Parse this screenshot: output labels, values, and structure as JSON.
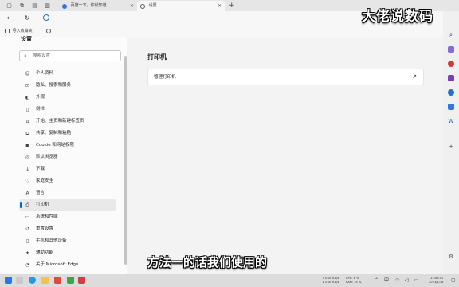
{
  "tabs": [
    {
      "title": "百度一下，你就知道",
      "active": false
    },
    {
      "title": "设置",
      "active": true
    }
  ],
  "favorites": [
    {
      "label": "导入收藏夹",
      "icon": "import-favorites-icon"
    },
    {
      "label": "",
      "icon": "folder-icon"
    }
  ],
  "settings": {
    "heading": "设置",
    "search_placeholder": "搜索设置",
    "nav": [
      {
        "label": "个人资料",
        "icon": "profile-icon",
        "active": false
      },
      {
        "label": "隐私、搜索和服务",
        "icon": "lock-icon",
        "active": false
      },
      {
        "label": "外观",
        "icon": "appearance-icon",
        "active": false
      },
      {
        "label": "侧栏",
        "icon": "sidebar-icon",
        "active": false
      },
      {
        "label": "开始、主页和新建标签页",
        "icon": "home-icon",
        "active": false
      },
      {
        "label": "共享、复制和粘贴",
        "icon": "share-icon",
        "active": false
      },
      {
        "label": "Cookie 和网站权限",
        "icon": "cookie-icon",
        "active": false
      },
      {
        "label": "默认浏览器",
        "icon": "default-browser-icon",
        "active": false
      },
      {
        "label": "下载",
        "icon": "download-icon",
        "active": false
      },
      {
        "label": "家庭安全",
        "icon": "family-icon",
        "active": false
      },
      {
        "label": "语言",
        "icon": "language-icon",
        "active": false
      },
      {
        "label": "打印机",
        "icon": "printer-icon",
        "active": true
      },
      {
        "label": "系统和性能",
        "icon": "system-icon",
        "active": false
      },
      {
        "label": "重置设置",
        "icon": "reset-icon",
        "active": false
      },
      {
        "label": "手机和其他设备",
        "icon": "phone-icon",
        "active": false
      },
      {
        "label": "辅助功能",
        "icon": "accessibility-icon",
        "active": false
      },
      {
        "label": "关于 Microsoft Edge",
        "icon": "edge-icon",
        "active": false
      }
    ],
    "page_title": "打印机",
    "card_label": "管理打印机"
  },
  "watermark": "大佬说数码",
  "subtitle": "方法一的话我们使用的",
  "taskbar": {
    "net_up": "↑ 0.00 KB/s",
    "net_down": "↓ 0.00 KB/s",
    "cpu": "CPU: 6 %",
    "ram": "RAM: 35 %",
    "time": "13:06:51",
    "date": "2023/1/18"
  }
}
